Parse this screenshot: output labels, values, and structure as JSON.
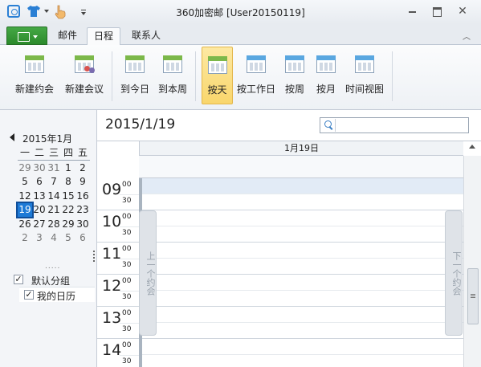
{
  "window": {
    "title": "360加密邮 [User20150119]"
  },
  "tabs": {
    "mail": "邮件",
    "schedule": "日程",
    "contacts": "联系人"
  },
  "ribbon": {
    "new_appointment": "新建约会",
    "new_meeting": "新建会议",
    "go_today": "到今日",
    "go_this_week": "到本周",
    "by_day": "按天",
    "by_work_week": "按工作日",
    "by_week": "按周",
    "by_month": "按月",
    "timeline_view": "时间视图"
  },
  "mini_calendar": {
    "month_label": "2015年1月",
    "weekdays": [
      "一",
      "二",
      "三",
      "四",
      "五"
    ],
    "weeks": [
      [
        "29",
        "30",
        "31",
        "1",
        "2"
      ],
      [
        "5",
        "6",
        "7",
        "8",
        "9"
      ],
      [
        "12",
        "13",
        "14",
        "15",
        "16"
      ],
      [
        "19",
        "20",
        "21",
        "22",
        "23"
      ],
      [
        "26",
        "27",
        "28",
        "29",
        "30"
      ],
      [
        "2",
        "3",
        "4",
        "5",
        "6"
      ]
    ],
    "selected": "19"
  },
  "calendar_groups": {
    "group_label": "默认分组",
    "calendar_label": "我的日历",
    "check_mark": "✓"
  },
  "day_view": {
    "date_title": "2015/1/19",
    "column_header": "1月19日",
    "hours": [
      "09",
      "10",
      "11",
      "12",
      "13",
      "14"
    ],
    "min_00": "00",
    "min_30": "30",
    "prev_label": "上一个约会",
    "next_label": "下一个约会"
  },
  "search": {
    "placeholder": ""
  },
  "colors": {
    "accent_green": "#2b8a2b",
    "selected_day": "#1e7ad6",
    "active_ribbon": "#f9d66c",
    "slot_highlight": "#e2ebf6"
  }
}
